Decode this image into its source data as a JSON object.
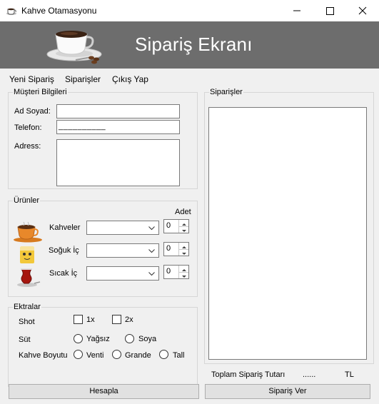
{
  "window": {
    "title": "Kahve Otamasyonu"
  },
  "banner": {
    "heading": "Sipariş Ekranı"
  },
  "menu": {
    "items": [
      "Yeni Sipariş",
      "Siparişler",
      "Çıkış Yap"
    ]
  },
  "customer": {
    "legend": "Müşteri Bilgileri",
    "name_label": "Ad Soyad:",
    "phone_label": "Telefon:",
    "phone_mask": "__________",
    "address_label": "Adress:"
  },
  "products": {
    "legend": "Ürünler",
    "qty_header": "Adet",
    "rows": [
      {
        "label": "Kahveler",
        "qty": "0",
        "icon": "coffee-cup-icon"
      },
      {
        "label": "Soğuk İç",
        "qty": "0",
        "icon": "cold-drink-icon"
      },
      {
        "label": "Sıcak İç",
        "qty": "0",
        "icon": "tea-glass-icon"
      }
    ]
  },
  "extras": {
    "legend": "Ektralar",
    "shot_label": "Shot",
    "shot_options": [
      "1x",
      "2x"
    ],
    "milk_label": "Süt",
    "milk_options": [
      "Yağsız",
      "Soya"
    ],
    "size_label": "Kahve Boyutu",
    "size_options": [
      "Venti",
      "Grande",
      "Tall"
    ]
  },
  "orders": {
    "legend": "Siparişler"
  },
  "totals": {
    "label": "Toplam Sipariş Tutarı",
    "value": "......",
    "currency": "TL"
  },
  "buttons": {
    "calculate": "Hesapla",
    "place_order": "Sipariş Ver"
  }
}
